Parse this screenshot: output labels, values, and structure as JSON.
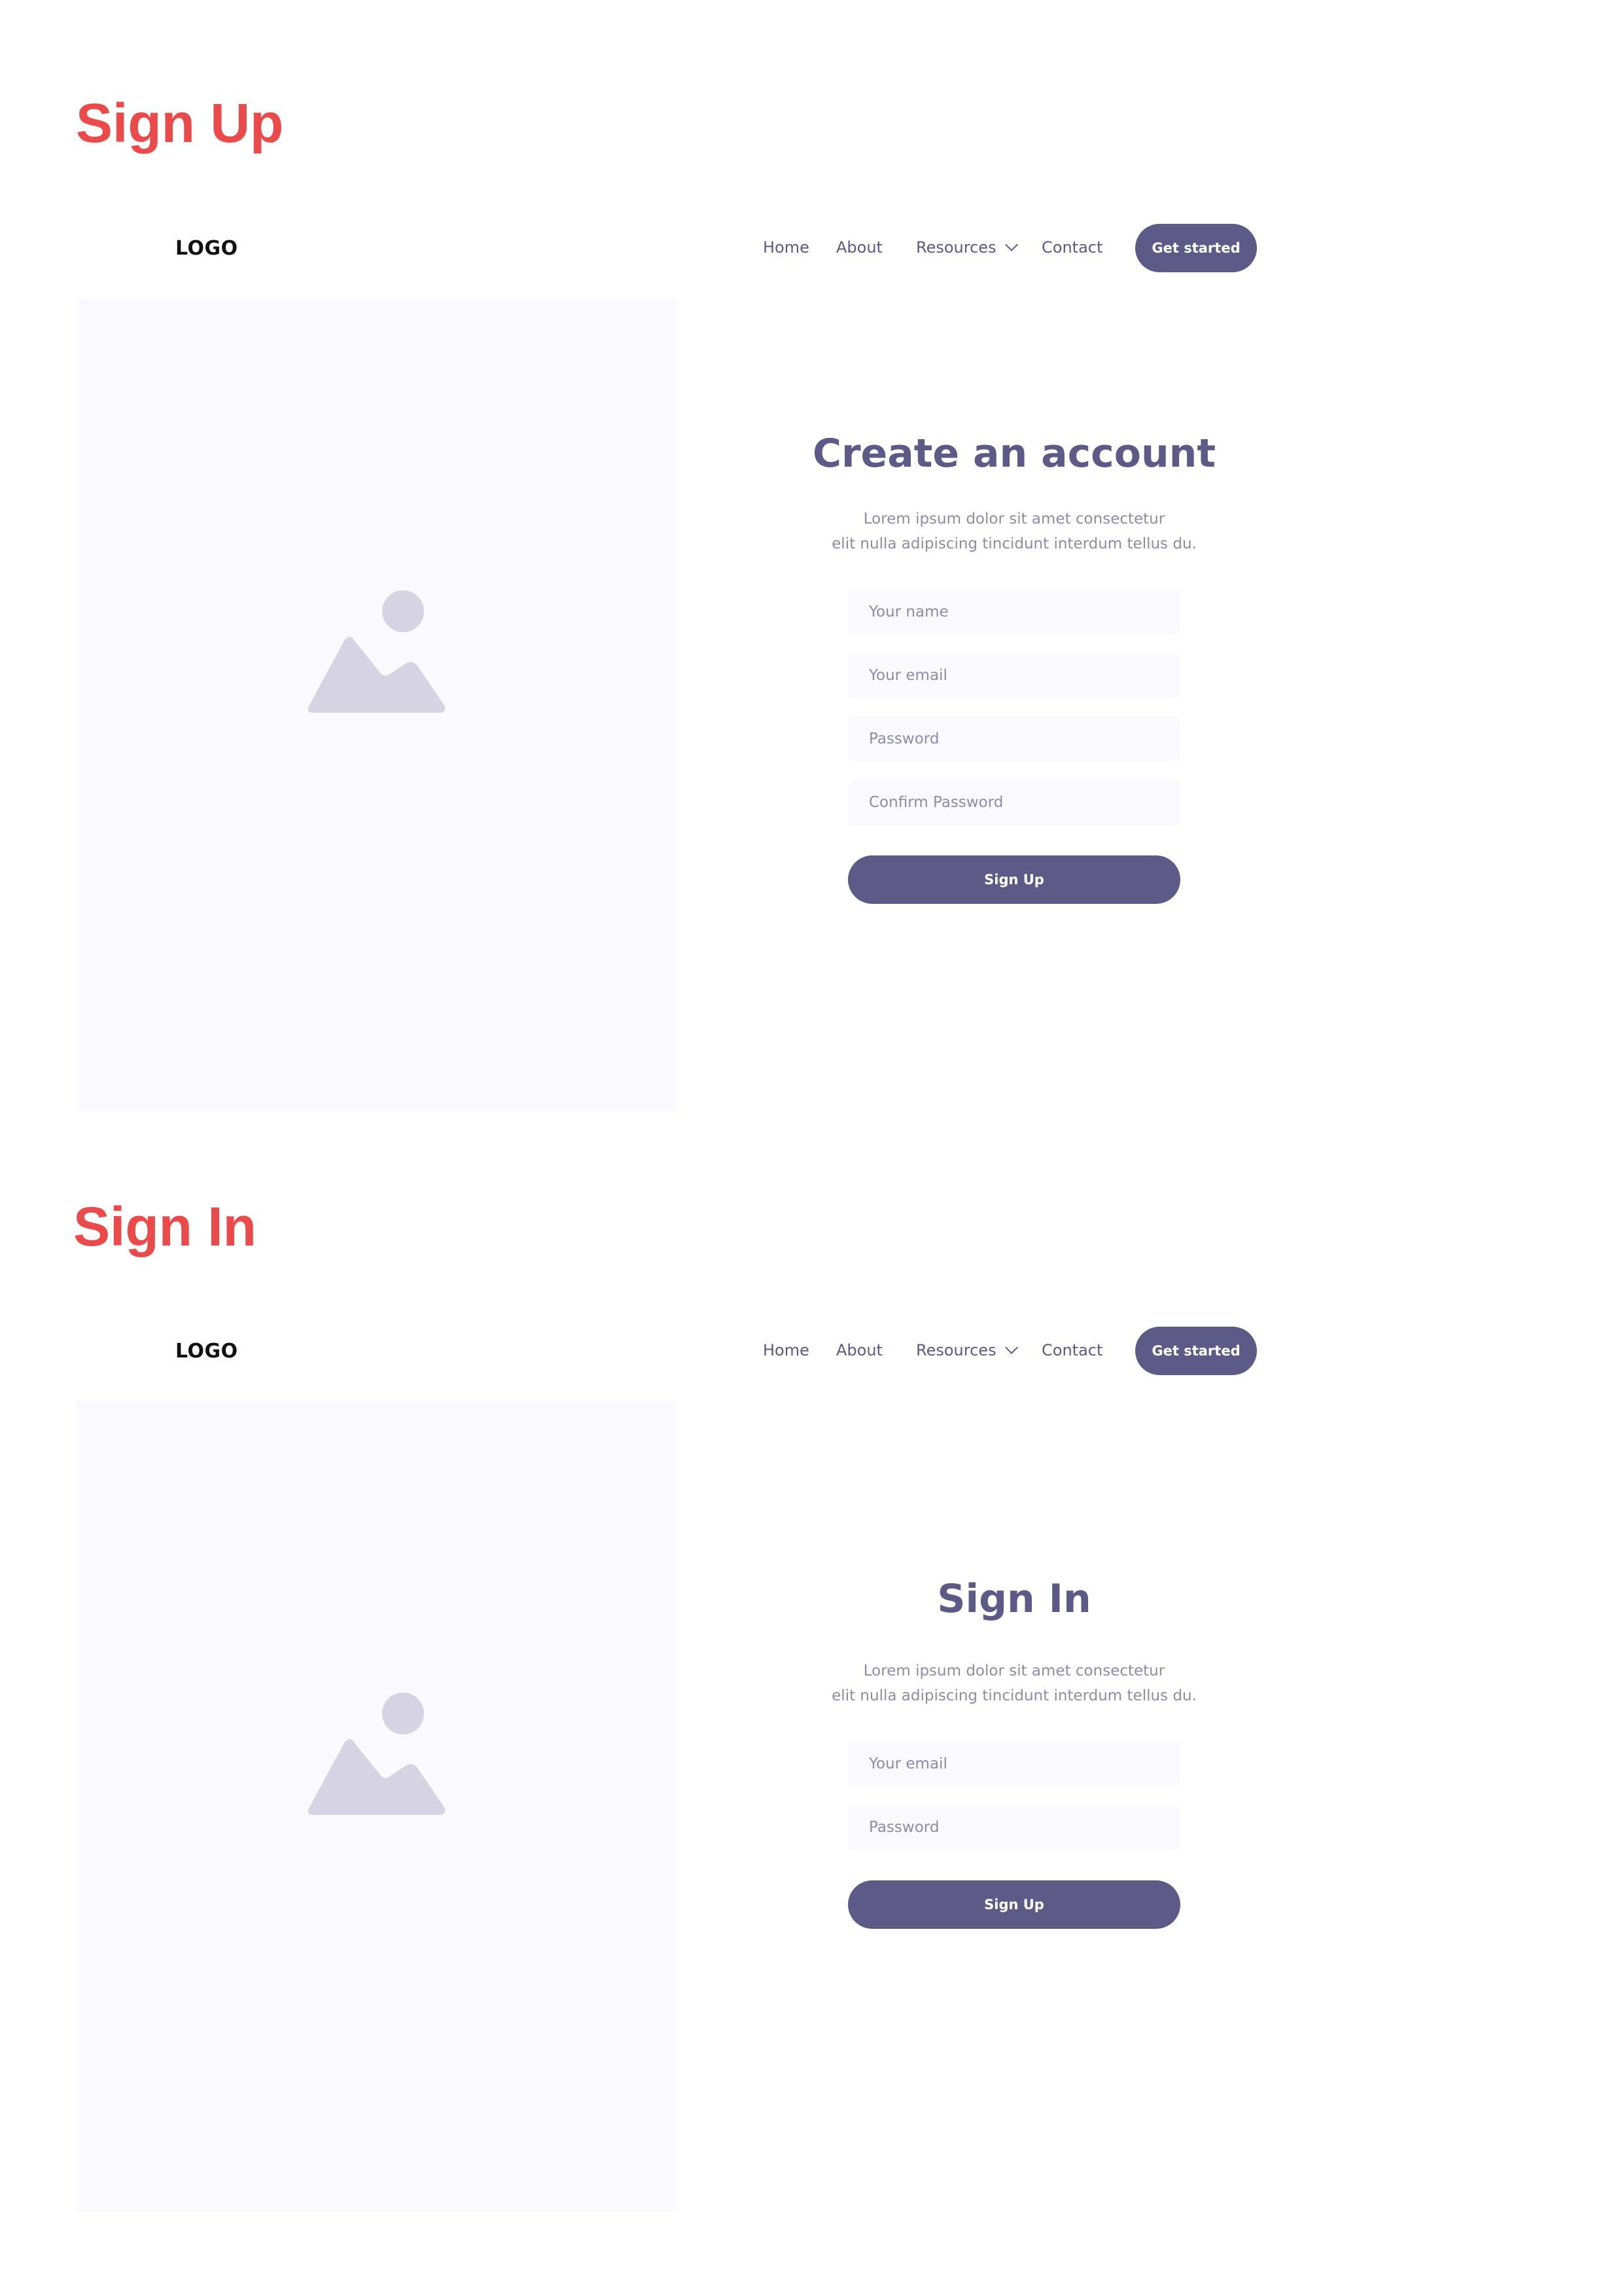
{
  "theme": {
    "accent": "#5e5a87",
    "heading_red": "#eb4a4a",
    "panel_bg": "#f9f9fe",
    "placeholder_icon": "#d6d3e3"
  },
  "signup_section": {
    "heading": "Sign Up",
    "nav": {
      "logo": "LOGO",
      "home": "Home",
      "about": "About",
      "resources": "Resources",
      "contact": "Contact",
      "cta": "Get started"
    },
    "image_icon": "image-placeholder-icon",
    "form": {
      "title": "Create an account",
      "desc_line1": "Lorem ipsum dolor sit amet consectetur",
      "desc_line2": "elit nulla adipiscing tincidunt interdum tellus du.",
      "name_placeholder": "Your name",
      "email_placeholder": "Your email",
      "password_placeholder": "Password",
      "confirm_placeholder": "Confirm Password",
      "submit": "Sign Up"
    }
  },
  "signin_section": {
    "heading": "Sign In",
    "nav": {
      "logo": "LOGO",
      "home": "Home",
      "about": "About",
      "resources": "Resources",
      "contact": "Contact",
      "cta": "Get started"
    },
    "image_icon": "image-placeholder-icon",
    "form": {
      "title": "Sign In",
      "desc_line1": "Lorem ipsum dolor sit amet consectetur",
      "desc_line2": "elit nulla adipiscing tincidunt interdum tellus du.",
      "email_placeholder": "Your email",
      "password_placeholder": "Password",
      "submit": "Sign Up"
    }
  }
}
